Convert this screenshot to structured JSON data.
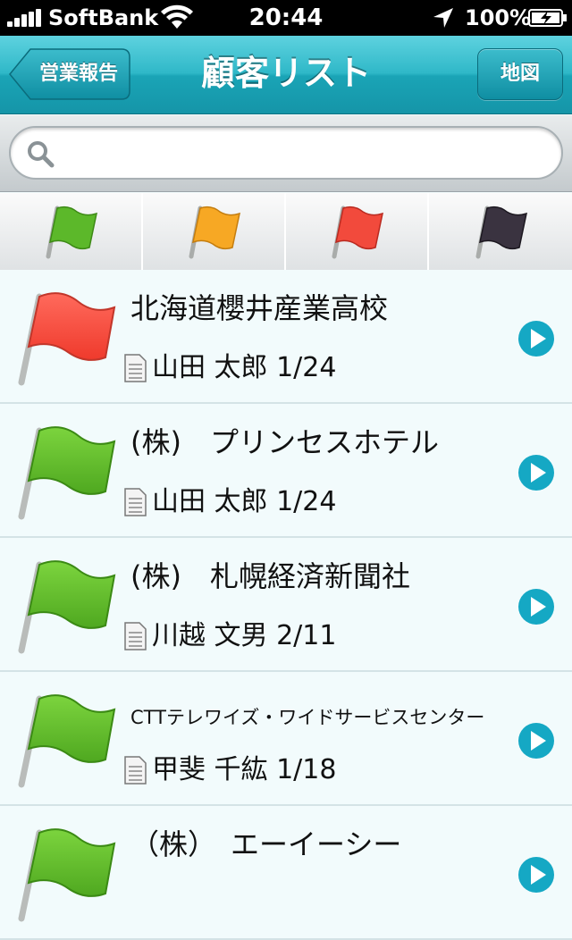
{
  "status_bar": {
    "carrier": "SoftBank",
    "time": "20:44",
    "battery": "100%"
  },
  "nav": {
    "back_label": "営業報告",
    "title": "顧客リスト",
    "map_label": "地図"
  },
  "search": {
    "placeholder": "",
    "value": ""
  },
  "filters": [
    {
      "color": "#5cb82a",
      "name": "green-flag"
    },
    {
      "color": "#f7a824",
      "name": "orange-flag"
    },
    {
      "color": "#f24a3c",
      "name": "red-flag"
    },
    {
      "color": "#3a3340",
      "name": "dark-flag"
    }
  ],
  "customers": [
    {
      "name": "北海道櫻井産業高校",
      "person": "山田 太郎 1/24",
      "flag_color": "#f24a3c"
    },
    {
      "name": "(株)　プリンセスホテル",
      "person": "山田 太郎 1/24",
      "flag_color": "#5cb82a"
    },
    {
      "name": "(株)　札幌経済新聞社",
      "person": "川越 文男 2/11",
      "flag_color": "#5cb82a"
    },
    {
      "name": "CTTテレワイズ・ワイドサービスセンター",
      "person": "甲斐 千紘 1/18",
      "flag_color": "#5cb82a"
    },
    {
      "name": "（株）　エーイーシー",
      "person": "",
      "flag_color": "#5cb82a"
    }
  ]
}
